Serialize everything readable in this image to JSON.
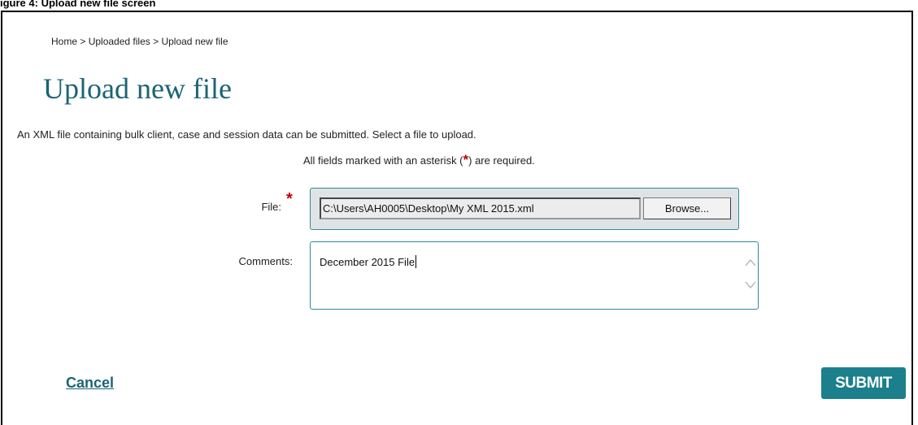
{
  "caption": "igure 4: Upload new file screen",
  "breadcrumb": {
    "items": [
      "Home",
      "Uploaded files",
      "Upload new file"
    ],
    "separator": ">"
  },
  "page": {
    "title": "Upload new file",
    "intro": "An XML file containing bulk client, case and session data can be submitted. Select a file to upload.",
    "required_note_prefix": "All fields marked with an asterisk (",
    "required_note_suffix": ") are required.",
    "asterisk": "*"
  },
  "form": {
    "file_label": "File:",
    "file_value": "C:\\Users\\AH0005\\Desktop\\My XML 2015.xml",
    "browse_label": "Browse...",
    "comments_label": "Comments:",
    "comments_value": "December 2015 File"
  },
  "actions": {
    "cancel_label": "Cancel",
    "submit_label": "SUBMIT"
  },
  "colors": {
    "accent": "#1b7f8c",
    "title": "#1a6474",
    "required": "#c00000"
  }
}
